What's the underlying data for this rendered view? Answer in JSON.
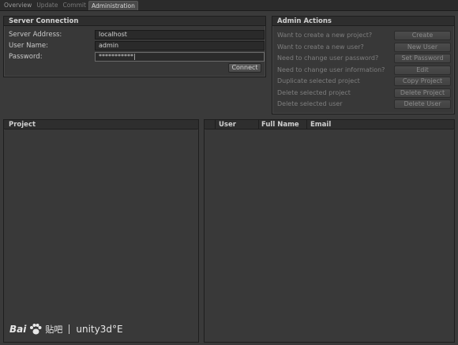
{
  "tabs": [
    {
      "label": "Overview",
      "state": "normal"
    },
    {
      "label": "Update",
      "state": "dim"
    },
    {
      "label": "Commit",
      "state": "dim"
    },
    {
      "label": "Administration",
      "state": "active"
    }
  ],
  "server": {
    "title": "Server Connection",
    "address_label": "Server Address:",
    "address_value": "localhost",
    "username_label": "User Name:",
    "username_value": "admin",
    "password_label": "Password:",
    "password_value": "***********|",
    "connect_label": "Connect"
  },
  "admin": {
    "title": "Admin Actions",
    "actions": [
      {
        "question": "Want to create a new project?",
        "button": "Create"
      },
      {
        "question": "Want to create a new user?",
        "button": "New User"
      },
      {
        "question": "Need to change user password?",
        "button": "Set Password"
      },
      {
        "question": "Need to change user information?",
        "button": "Edit"
      },
      {
        "question": "Duplicate selected project",
        "button": "Copy Project"
      },
      {
        "question": "Delete selected project",
        "button": "Delete Project"
      },
      {
        "question": "Delete selected user",
        "button": "Delete User"
      }
    ]
  },
  "project": {
    "header": "Project"
  },
  "users": {
    "columns": [
      "User",
      "Full Name",
      "Email"
    ]
  },
  "watermark": {
    "brand": "Bai",
    "brand2": "贴吧",
    "text": "unity3d°E"
  },
  "colors": {
    "background": "#3a3a3a",
    "panel": "#383838",
    "header": "#2e2e2e",
    "text": "#c8c8c8",
    "disabled_text": "#7e7e7e"
  }
}
